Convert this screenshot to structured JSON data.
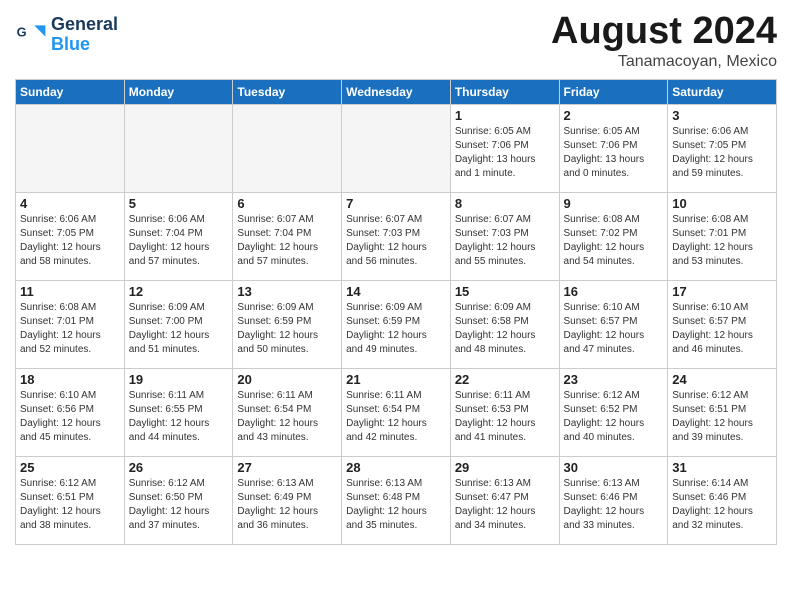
{
  "logo": {
    "line1": "General",
    "line2": "Blue"
  },
  "title": "August 2024",
  "location": "Tanamacoyan, Mexico",
  "weekdays": [
    "Sunday",
    "Monday",
    "Tuesday",
    "Wednesday",
    "Thursday",
    "Friday",
    "Saturday"
  ],
  "weeks": [
    [
      {
        "day": "",
        "info": ""
      },
      {
        "day": "",
        "info": ""
      },
      {
        "day": "",
        "info": ""
      },
      {
        "day": "",
        "info": ""
      },
      {
        "day": "1",
        "info": "Sunrise: 6:05 AM\nSunset: 7:06 PM\nDaylight: 13 hours\nand 1 minute."
      },
      {
        "day": "2",
        "info": "Sunrise: 6:05 AM\nSunset: 7:06 PM\nDaylight: 13 hours\nand 0 minutes."
      },
      {
        "day": "3",
        "info": "Sunrise: 6:06 AM\nSunset: 7:05 PM\nDaylight: 12 hours\nand 59 minutes."
      }
    ],
    [
      {
        "day": "4",
        "info": "Sunrise: 6:06 AM\nSunset: 7:05 PM\nDaylight: 12 hours\nand 58 minutes."
      },
      {
        "day": "5",
        "info": "Sunrise: 6:06 AM\nSunset: 7:04 PM\nDaylight: 12 hours\nand 57 minutes."
      },
      {
        "day": "6",
        "info": "Sunrise: 6:07 AM\nSunset: 7:04 PM\nDaylight: 12 hours\nand 57 minutes."
      },
      {
        "day": "7",
        "info": "Sunrise: 6:07 AM\nSunset: 7:03 PM\nDaylight: 12 hours\nand 56 minutes."
      },
      {
        "day": "8",
        "info": "Sunrise: 6:07 AM\nSunset: 7:03 PM\nDaylight: 12 hours\nand 55 minutes."
      },
      {
        "day": "9",
        "info": "Sunrise: 6:08 AM\nSunset: 7:02 PM\nDaylight: 12 hours\nand 54 minutes."
      },
      {
        "day": "10",
        "info": "Sunrise: 6:08 AM\nSunset: 7:01 PM\nDaylight: 12 hours\nand 53 minutes."
      }
    ],
    [
      {
        "day": "11",
        "info": "Sunrise: 6:08 AM\nSunset: 7:01 PM\nDaylight: 12 hours\nand 52 minutes."
      },
      {
        "day": "12",
        "info": "Sunrise: 6:09 AM\nSunset: 7:00 PM\nDaylight: 12 hours\nand 51 minutes."
      },
      {
        "day": "13",
        "info": "Sunrise: 6:09 AM\nSunset: 6:59 PM\nDaylight: 12 hours\nand 50 minutes."
      },
      {
        "day": "14",
        "info": "Sunrise: 6:09 AM\nSunset: 6:59 PM\nDaylight: 12 hours\nand 49 minutes."
      },
      {
        "day": "15",
        "info": "Sunrise: 6:09 AM\nSunset: 6:58 PM\nDaylight: 12 hours\nand 48 minutes."
      },
      {
        "day": "16",
        "info": "Sunrise: 6:10 AM\nSunset: 6:57 PM\nDaylight: 12 hours\nand 47 minutes."
      },
      {
        "day": "17",
        "info": "Sunrise: 6:10 AM\nSunset: 6:57 PM\nDaylight: 12 hours\nand 46 minutes."
      }
    ],
    [
      {
        "day": "18",
        "info": "Sunrise: 6:10 AM\nSunset: 6:56 PM\nDaylight: 12 hours\nand 45 minutes."
      },
      {
        "day": "19",
        "info": "Sunrise: 6:11 AM\nSunset: 6:55 PM\nDaylight: 12 hours\nand 44 minutes."
      },
      {
        "day": "20",
        "info": "Sunrise: 6:11 AM\nSunset: 6:54 PM\nDaylight: 12 hours\nand 43 minutes."
      },
      {
        "day": "21",
        "info": "Sunrise: 6:11 AM\nSunset: 6:54 PM\nDaylight: 12 hours\nand 42 minutes."
      },
      {
        "day": "22",
        "info": "Sunrise: 6:11 AM\nSunset: 6:53 PM\nDaylight: 12 hours\nand 41 minutes."
      },
      {
        "day": "23",
        "info": "Sunrise: 6:12 AM\nSunset: 6:52 PM\nDaylight: 12 hours\nand 40 minutes."
      },
      {
        "day": "24",
        "info": "Sunrise: 6:12 AM\nSunset: 6:51 PM\nDaylight: 12 hours\nand 39 minutes."
      }
    ],
    [
      {
        "day": "25",
        "info": "Sunrise: 6:12 AM\nSunset: 6:51 PM\nDaylight: 12 hours\nand 38 minutes."
      },
      {
        "day": "26",
        "info": "Sunrise: 6:12 AM\nSunset: 6:50 PM\nDaylight: 12 hours\nand 37 minutes."
      },
      {
        "day": "27",
        "info": "Sunrise: 6:13 AM\nSunset: 6:49 PM\nDaylight: 12 hours\nand 36 minutes."
      },
      {
        "day": "28",
        "info": "Sunrise: 6:13 AM\nSunset: 6:48 PM\nDaylight: 12 hours\nand 35 minutes."
      },
      {
        "day": "29",
        "info": "Sunrise: 6:13 AM\nSunset: 6:47 PM\nDaylight: 12 hours\nand 34 minutes."
      },
      {
        "day": "30",
        "info": "Sunrise: 6:13 AM\nSunset: 6:46 PM\nDaylight: 12 hours\nand 33 minutes."
      },
      {
        "day": "31",
        "info": "Sunrise: 6:14 AM\nSunset: 6:46 PM\nDaylight: 12 hours\nand 32 minutes."
      }
    ]
  ]
}
